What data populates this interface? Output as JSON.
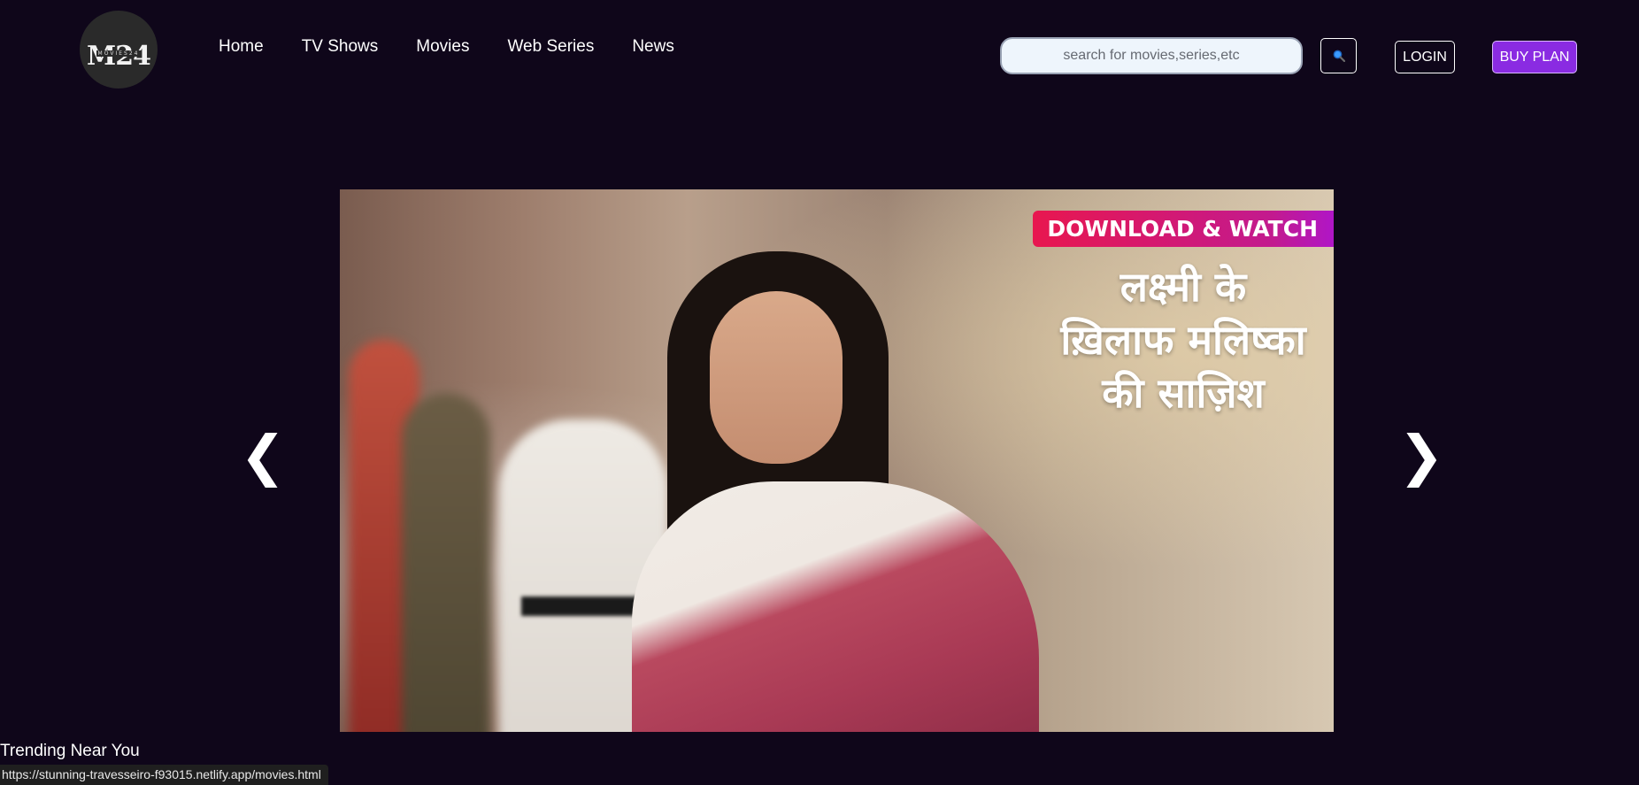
{
  "logo": {
    "mark": "M24",
    "subtitle": "MOVIES24"
  },
  "nav": {
    "items": [
      {
        "label": "Home"
      },
      {
        "label": "TV Shows"
      },
      {
        "label": "Movies"
      },
      {
        "label": "Web Series"
      },
      {
        "label": "News"
      }
    ]
  },
  "search": {
    "placeholder": "search for movies,series,etc",
    "icon": "search-icon"
  },
  "auth": {
    "login_label": "LOGIN",
    "buy_label": "BUY PLAN"
  },
  "colors": {
    "background": "#0f061a",
    "buy_plan": "#8a2be2",
    "badge_start": "#e8174f",
    "badge_end": "#b016c7"
  },
  "carousel": {
    "prev_label": "❮",
    "next_label": "❯",
    "slide": {
      "badge": "DOWNLOAD & WATCH",
      "headline_lines": [
        "लक्ष्मी के",
        "ख़िलाफ मलिष्का",
        "की साज़िश"
      ]
    }
  },
  "sections": {
    "trending_title": "Trending Near You"
  },
  "status_bar": {
    "url": "https://stunning-travesseiro-f93015.netlify.app/movies.html"
  }
}
